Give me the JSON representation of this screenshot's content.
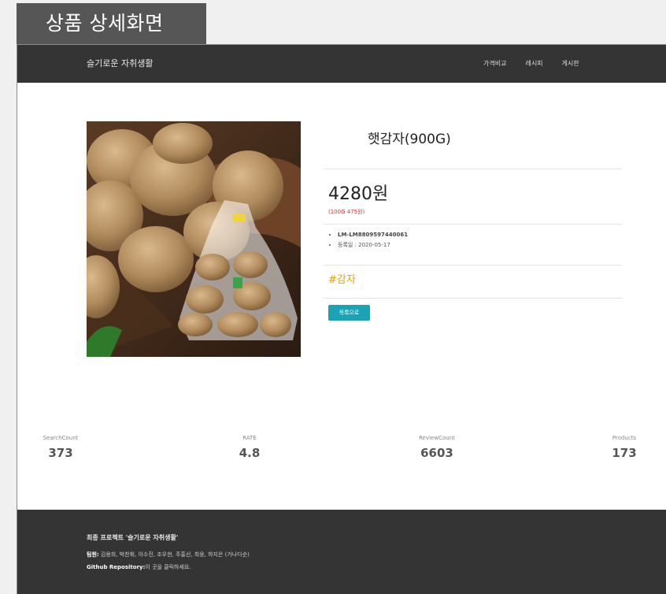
{
  "page_title": "상품 상세화면",
  "navbar": {
    "brand": "슬기로운 자취생활",
    "links": [
      "가격비교",
      "레시피",
      "게시판"
    ]
  },
  "product": {
    "name": "햇감자(900G)",
    "price": "4280원",
    "unit_price": "(100G 475원)",
    "meta": [
      "LM-LM8809597440061",
      "등록일 : 2020-05-17"
    ],
    "tag": "#감자",
    "back_button": "목록으로",
    "image_alt": "potatoes-photo"
  },
  "stats": [
    {
      "label": "SearchCount",
      "value": "373"
    },
    {
      "label": "RATE",
      "value": "4.8"
    },
    {
      "label": "ReviewCount",
      "value": "6603"
    },
    {
      "label": "Products",
      "value": "173"
    }
  ],
  "footer": {
    "title": "최종 프로젝트 '슬기로운 자취생활'",
    "team_label": "팀원:",
    "team_members": " 김용희, 박찬휘, 이수진, 조우현, 주홍선, 최웅, 하지은 (가나다순)",
    "repo_label": "Github Repository:",
    "repo_text": "이 곳을 클릭하세요."
  },
  "colors": {
    "nav_bg": "#343434",
    "accent_button": "#1aa3b4",
    "tag": "#e8a200",
    "unit_price": "#d9342b"
  }
}
